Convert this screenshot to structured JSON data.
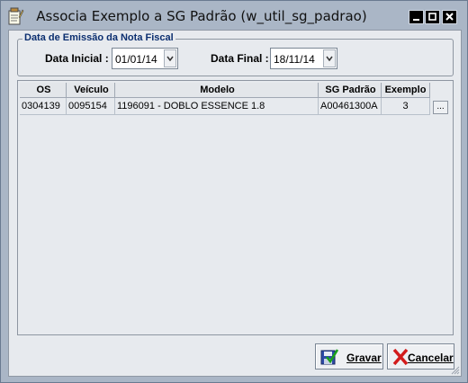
{
  "window": {
    "title": "Associa Exemplo a SG Padrão (w_util_sg_padrao)",
    "icons": {
      "app": "notepad-pencil-icon",
      "minimize": "minimize-icon",
      "maximize": "maximize-icon",
      "close": "close-icon"
    }
  },
  "filter": {
    "group_title": "Data de Emissão da Nota Fiscal",
    "start_label": "Data Inicial :",
    "start_value": "01/01/14",
    "end_label": "Data Final :",
    "end_value": "18/11/14"
  },
  "grid": {
    "columns": [
      "OS",
      "Veículo",
      "Modelo",
      "SG Padrão",
      "Exemplo"
    ],
    "rows": [
      {
        "os": "0304139",
        "veiculo": "0095154",
        "modelo": "1196091 - DOBLO ESSENCE 1.8",
        "sg_padrao": "A00461300A",
        "exemplo": "3",
        "action": "..."
      }
    ]
  },
  "buttons": {
    "save": "Gravar",
    "cancel": "Cancelar"
  },
  "colors": {
    "window_frame": "#aab6c6",
    "client_bg": "#e7eaee",
    "group_title": "#0b2e6f"
  }
}
